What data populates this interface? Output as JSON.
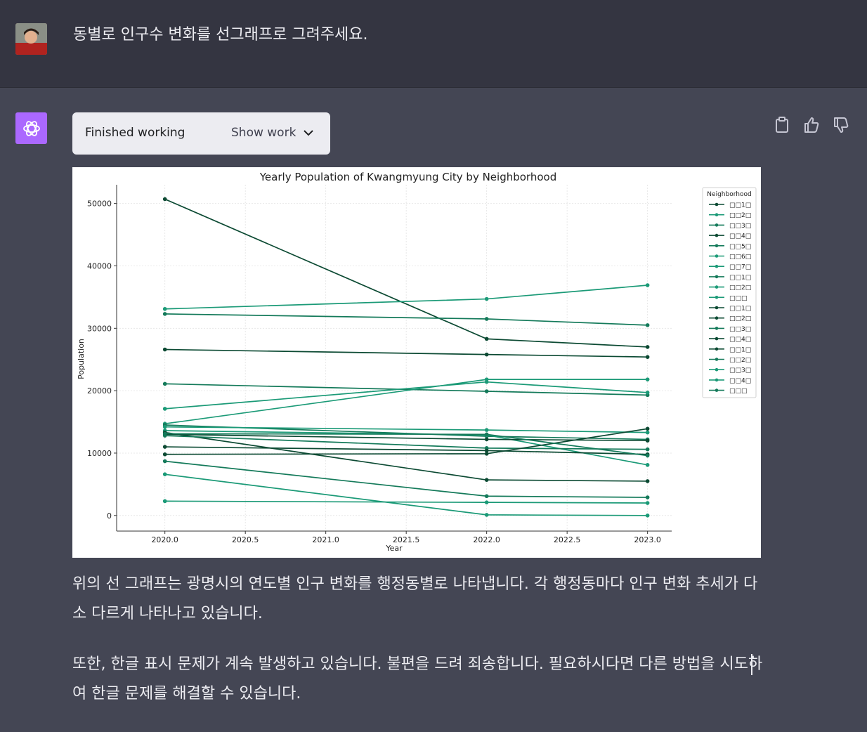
{
  "user": {
    "avatar_icon": "user-avatar",
    "message": "동별로 인구수 변화를 선그래프로 그려주세요."
  },
  "assistant": {
    "icon": "openai-logo-icon",
    "work_status": "Finished working",
    "show_work_label": "Show work",
    "actions": [
      "clipboard-icon",
      "thumbs-up-icon",
      "thumbs-down-icon"
    ],
    "answer_p1": "위의 선 그래프는 광명시의 연도별 인구 변화를 행정동별로 나타냅니다. 각 행정동마다 인구 변화 추세가 다소 다르게 나타나고 있습니다.",
    "answer_p2": "또한, 한글 표시 문제가 계속 발생하고 있습니다. 불편을 드려 죄송합니다. 필요하시다면 다른 방법을 시도하여 한글 문제를 해결할 수 있습니다."
  },
  "chart_data": {
    "type": "line",
    "title": "Yearly Population of Kwangmyung City by Neighborhood",
    "xlabel": "Year",
    "ylabel": "Population",
    "xlim": [
      2019.7,
      2023.15
    ],
    "ylim": [
      -2500,
      53000
    ],
    "xticks": [
      "2020.0",
      "2020.5",
      "2021.0",
      "2021.5",
      "2022.0",
      "2022.5",
      "2023.0"
    ],
    "yticks": [
      "0",
      "10000",
      "20000",
      "30000",
      "40000",
      "50000"
    ],
    "grid": true,
    "legend_title": "Neighborhood",
    "legend_position": "upper-right",
    "legend_labels": [
      "□□1□",
      "□□2□",
      "□□3□",
      "□□4□",
      "□□5□",
      "□□6□",
      "□□7□",
      "□□1□",
      "□□2□",
      "□□□",
      "□□1□",
      "□□2□",
      "□□3□",
      "□□4□",
      "□□1□",
      "□□2□",
      "□□3□",
      "□□4□",
      "□□□"
    ],
    "x": [
      2020,
      2022,
      2023
    ],
    "colors": [
      "#0c4a33",
      "#1b9a77",
      "#147a5a"
    ],
    "series": [
      {
        "values": [
          50700,
          28300,
          27000
        ],
        "color": "#0c4a33"
      },
      {
        "values": [
          33100,
          34700,
          36900
        ],
        "color": "#1b9a77"
      },
      {
        "values": [
          32300,
          31500,
          30500
        ],
        "color": "#147a5a"
      },
      {
        "values": [
          26600,
          25800,
          25400
        ],
        "color": "#0c4a33"
      },
      {
        "values": [
          21100,
          19900,
          19300
        ],
        "color": "#147a5a"
      },
      {
        "values": [
          17100,
          21400,
          19700
        ],
        "color": "#1b9a77"
      },
      {
        "values": [
          14700,
          21800,
          21800
        ],
        "color": "#1b9a77"
      },
      {
        "values": [
          14500,
          12700,
          12200
        ],
        "color": "#147a5a"
      },
      {
        "values": [
          14200,
          13700,
          13300
        ],
        "color": "#1b9a77"
      },
      {
        "values": [
          13600,
          12900,
          8100
        ],
        "color": "#1b9a77"
      },
      {
        "values": [
          13300,
          5700,
          5500
        ],
        "color": "#0c4a33"
      },
      {
        "values": [
          13000,
          12200,
          12000
        ],
        "color": "#0c4a33"
      },
      {
        "values": [
          12800,
          10800,
          10600
        ],
        "color": "#147a5a"
      },
      {
        "values": [
          11000,
          10400,
          9800
        ],
        "color": "#0c4a33"
      },
      {
        "values": [
          9800,
          9900,
          13900
        ],
        "color": "#0c4a33"
      },
      {
        "values": [
          8700,
          3100,
          2900
        ],
        "color": "#147a5a"
      },
      {
        "values": [
          6600,
          100,
          0
        ],
        "color": "#1b9a77"
      },
      {
        "values": [
          2300,
          2100,
          2000
        ],
        "color": "#1b9a77"
      },
      {
        "values": [
          13100,
          13000,
          9600
        ],
        "color": "#147a5a"
      }
    ]
  }
}
